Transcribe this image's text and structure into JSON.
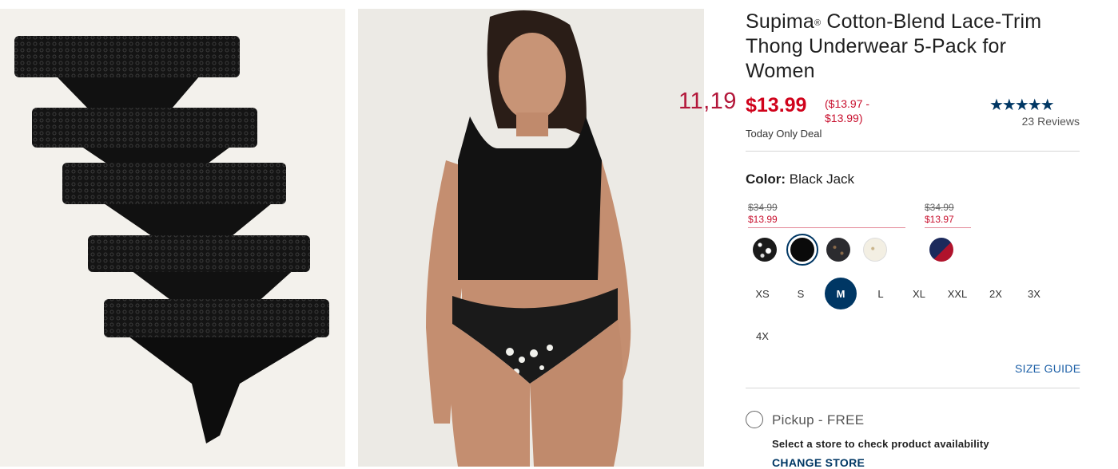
{
  "overlay_price": "11,19",
  "product": {
    "title_prefix": "Supima",
    "title_mark": "®",
    "title_rest": " Cotton-Blend Lace-Trim Thong Underwear 5-Pack for Women",
    "price": "$13.99",
    "price_range": "($13.97 - $13.99)",
    "deal_label": "Today Only Deal",
    "rating_stars": "★★★★★",
    "rating_value": 4.6,
    "reviews": "23 Reviews"
  },
  "color": {
    "label": "Color:",
    "value": "Black Jack",
    "groups": [
      {
        "was": "$34.99",
        "now": "$13.99"
      },
      {
        "was": "$34.99",
        "now": "$13.97"
      }
    ]
  },
  "sizes": [
    "XS",
    "S",
    "M",
    "L",
    "XL",
    "XXL",
    "2X",
    "3X",
    "4X"
  ],
  "selected_size": "M",
  "size_guide": "SIZE GUIDE",
  "pickup": {
    "label": "Pickup - FREE",
    "message": "Select a store to check product availability",
    "change_store": "CHANGE STORE"
  },
  "colors": {
    "accent_navy": "#003764",
    "sale_red": "#d0021b",
    "link_blue": "#1a5ea6"
  }
}
